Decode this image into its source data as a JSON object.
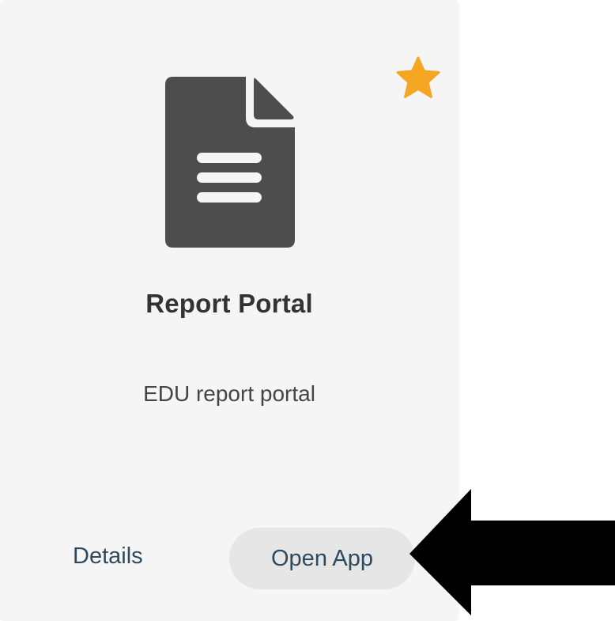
{
  "card": {
    "title": "Report Portal",
    "description": "EDU report portal",
    "icon": "document-icon",
    "favorite": true,
    "favorite_icon": "star-icon",
    "favorite_color": "#f5a623",
    "icon_color": "#4d4d4d",
    "actions": {
      "details_label": "Details",
      "open_label": "Open App"
    }
  },
  "annotation": {
    "icon": "arrow-left-icon",
    "color": "#000000"
  }
}
